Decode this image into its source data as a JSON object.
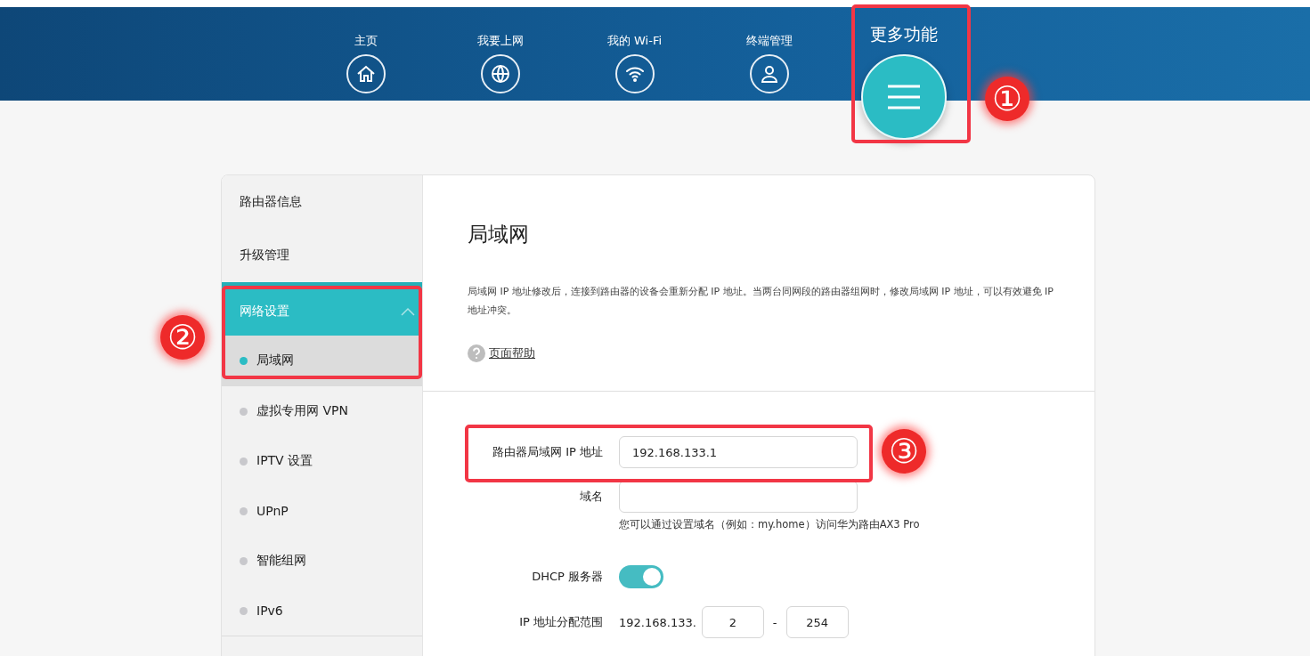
{
  "nav": [
    {
      "label": "主页",
      "kind": "home",
      "selected": false
    },
    {
      "label": "我要上网",
      "kind": "globe",
      "selected": false
    },
    {
      "label": "我的 Wi-Fi",
      "kind": "wifi",
      "selected": false
    },
    {
      "label": "终端管理",
      "kind": "user",
      "selected": false
    },
    {
      "label": "更多功能",
      "kind": "menu",
      "selected": true
    }
  ],
  "sidebar": {
    "items": [
      {
        "label": "路由器信息",
        "kind": "item",
        "selected": false
      },
      {
        "label": "升级管理",
        "kind": "item",
        "selected": false
      },
      {
        "label": "网络设置",
        "kind": "group",
        "selected": true,
        "expanded": true,
        "children": [
          {
            "label": "局域网",
            "selected": true
          },
          {
            "label": "虚拟专用网 VPN",
            "selected": false
          },
          {
            "label": "IPTV 设置",
            "selected": false
          },
          {
            "label": "UPnP",
            "selected": false
          },
          {
            "label": "智能组网",
            "selected": false
          },
          {
            "label": "IPv6",
            "selected": false
          }
        ]
      }
    ]
  },
  "content": {
    "title": "局域网",
    "description": "局域网 IP 地址修改后，连接到路由器的设备会重新分配 IP 地址。当两台同网段的路由器组网时，修改局域网 IP 地址，可以有效避免 IP 地址冲突。",
    "help_link": "页面帮助",
    "form": {
      "ip": {
        "label": "路由器局域网 IP 地址",
        "value": "192.168.133.1"
      },
      "domain": {
        "label": "域名",
        "hint": "您可以通过设置域名（例如：my.home）访问华为路由AX3 Pro"
      },
      "dhcp": {
        "label": "DHCP 服务器",
        "on": true
      },
      "range": {
        "label": "IP 地址分配范围",
        "prefix": "192.168.133.",
        "start": "2",
        "separator": "-",
        "end": "254"
      }
    }
  },
  "annotations": [
    {
      "label": "①"
    },
    {
      "label": "②"
    },
    {
      "label": "③"
    }
  ]
}
